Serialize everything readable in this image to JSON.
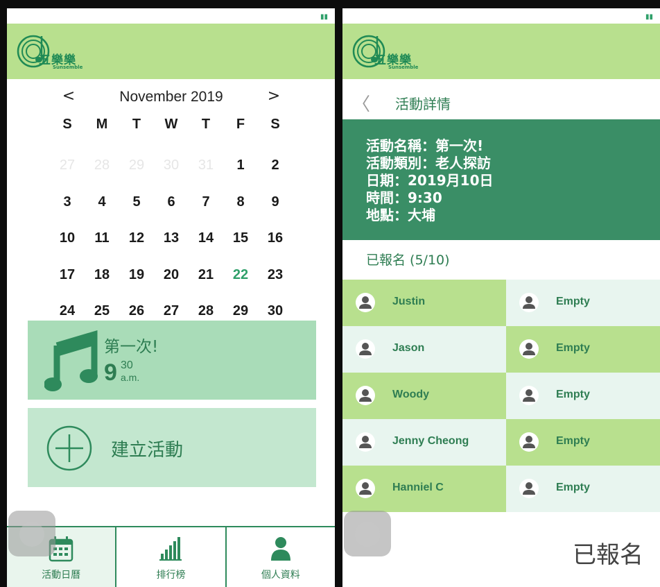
{
  "left": {
    "logo": {
      "text": "五樂樂",
      "sub": "Sunsemble"
    },
    "calendar": {
      "prev": "<",
      "next": ">",
      "title": "November 2019",
      "weekdays": [
        "S",
        "M",
        "T",
        "W",
        "T",
        "F",
        "S"
      ],
      "weeks": [
        [
          {
            "d": "27",
            "t": "muted"
          },
          {
            "d": "28",
            "t": "muted"
          },
          {
            "d": "29",
            "t": "muted"
          },
          {
            "d": "30",
            "t": "muted"
          },
          {
            "d": "31",
            "t": "muted"
          },
          {
            "d": "1",
            "t": ""
          },
          {
            "d": "2",
            "t": ""
          }
        ],
        [
          {
            "d": "3",
            "t": ""
          },
          {
            "d": "4",
            "t": ""
          },
          {
            "d": "5",
            "t": ""
          },
          {
            "d": "6",
            "t": ""
          },
          {
            "d": "7",
            "t": ""
          },
          {
            "d": "8",
            "t": ""
          },
          {
            "d": "9",
            "t": ""
          }
        ],
        [
          {
            "d": "10",
            "t": "today"
          },
          {
            "d": "11",
            "t": ""
          },
          {
            "d": "12",
            "t": ""
          },
          {
            "d": "13",
            "t": ""
          },
          {
            "d": "14",
            "t": ""
          },
          {
            "d": "15",
            "t": ""
          },
          {
            "d": "16",
            "t": ""
          }
        ],
        [
          {
            "d": "17",
            "t": ""
          },
          {
            "d": "18",
            "t": ""
          },
          {
            "d": "19",
            "t": ""
          },
          {
            "d": "20",
            "t": ""
          },
          {
            "d": "21",
            "t": ""
          },
          {
            "d": "22",
            "t": "event"
          },
          {
            "d": "23",
            "t": ""
          }
        ],
        [
          {
            "d": "24",
            "t": ""
          },
          {
            "d": "25",
            "t": ""
          },
          {
            "d": "26",
            "t": ""
          },
          {
            "d": "27",
            "t": ""
          },
          {
            "d": "28",
            "t": ""
          },
          {
            "d": "29",
            "t": ""
          },
          {
            "d": "30",
            "t": ""
          }
        ]
      ]
    },
    "event_card": {
      "icon": "music-note-icon",
      "name": "第一次!",
      "hour": "9",
      "minute": "30",
      "ampm": "a.m."
    },
    "create_card": {
      "icon": "plus-circle-icon",
      "label": "建立活動"
    },
    "tabs": [
      {
        "icon": "calendar-icon",
        "label": "活動日曆",
        "active": true
      },
      {
        "icon": "bar-chart-icon",
        "label": "排行榜",
        "active": false
      },
      {
        "icon": "person-icon",
        "label": "個人資料",
        "active": false
      }
    ]
  },
  "right": {
    "logo": {
      "text": "五樂樂",
      "sub": "Sunsemble"
    },
    "nav": {
      "back": "〈",
      "title": "活動詳情"
    },
    "details": [
      "活動名稱：第一次!",
      "活動類別：老人探訪",
      "日期：2019月10日",
      "時間：9:30",
      "地點：大埔"
    ],
    "registered_header": "已報名 (5/10)",
    "participants": [
      [
        "Justin",
        "Empty"
      ],
      [
        "Jason",
        "Empty"
      ],
      [
        "Woody",
        "Empty"
      ],
      [
        "Jenny Cheong",
        "Empty"
      ],
      [
        "Hanniel C",
        "Empty"
      ]
    ],
    "register_button": "已報名"
  },
  "colors": {
    "header_green": "#b8e08e",
    "dark_green": "#3a8e66",
    "text_green": "#2e7d52",
    "light_mint": "#e8f5ef"
  }
}
